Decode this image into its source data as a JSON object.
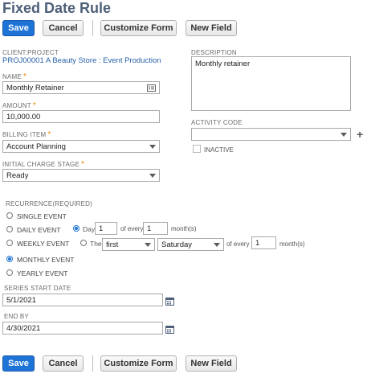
{
  "title": "Fixed Date Rule",
  "buttons": {
    "save": "Save",
    "cancel": "Cancel",
    "customize": "Customize Form",
    "new_field": "New Field"
  },
  "client_project": {
    "label": "CLIENT:PROJECT",
    "value": "PROJ00001 A Beauty Store : Event Production"
  },
  "name": {
    "label": "NAME",
    "value": "Monthly Retainer",
    "icon": "list-icon"
  },
  "amount": {
    "label": "AMOUNT",
    "value": "10,000.00"
  },
  "billing_item": {
    "label": "BILLING ITEM",
    "value": "Account Planning"
  },
  "initial_charge_stage": {
    "label": "INITIAL CHARGE STAGE",
    "value": "Ready"
  },
  "description": {
    "label": "DESCRIPTION",
    "value": "Monthly retainer"
  },
  "activity_code": {
    "label": "ACTIVITY CODE",
    "value": ""
  },
  "inactive": {
    "label": "INACTIVE",
    "checked": false
  },
  "recurrence": {
    "label": "RECURRENCE(REQUIRED)",
    "options": [
      "SINGLE EVENT",
      "DAILY EVENT",
      "WEEKLY EVENT",
      "MONTHLY EVENT",
      "YEARLY EVENT"
    ],
    "selected": "MONTHLY EVENT",
    "day_option": {
      "label": "Day",
      "day_value": "1",
      "of_every": "of every",
      "every_value": "1",
      "unit": "month(s)"
    },
    "the_option": {
      "label": "The",
      "ordinal": "first",
      "weekday": "Saturday",
      "of_every": "of every",
      "every_value": "1",
      "unit": "month(s)"
    }
  },
  "series_start_date": {
    "label": "SERIES START DATE",
    "value": "5/1/2021"
  },
  "end_by": {
    "label": "END BY",
    "value": "4/30/2021"
  }
}
